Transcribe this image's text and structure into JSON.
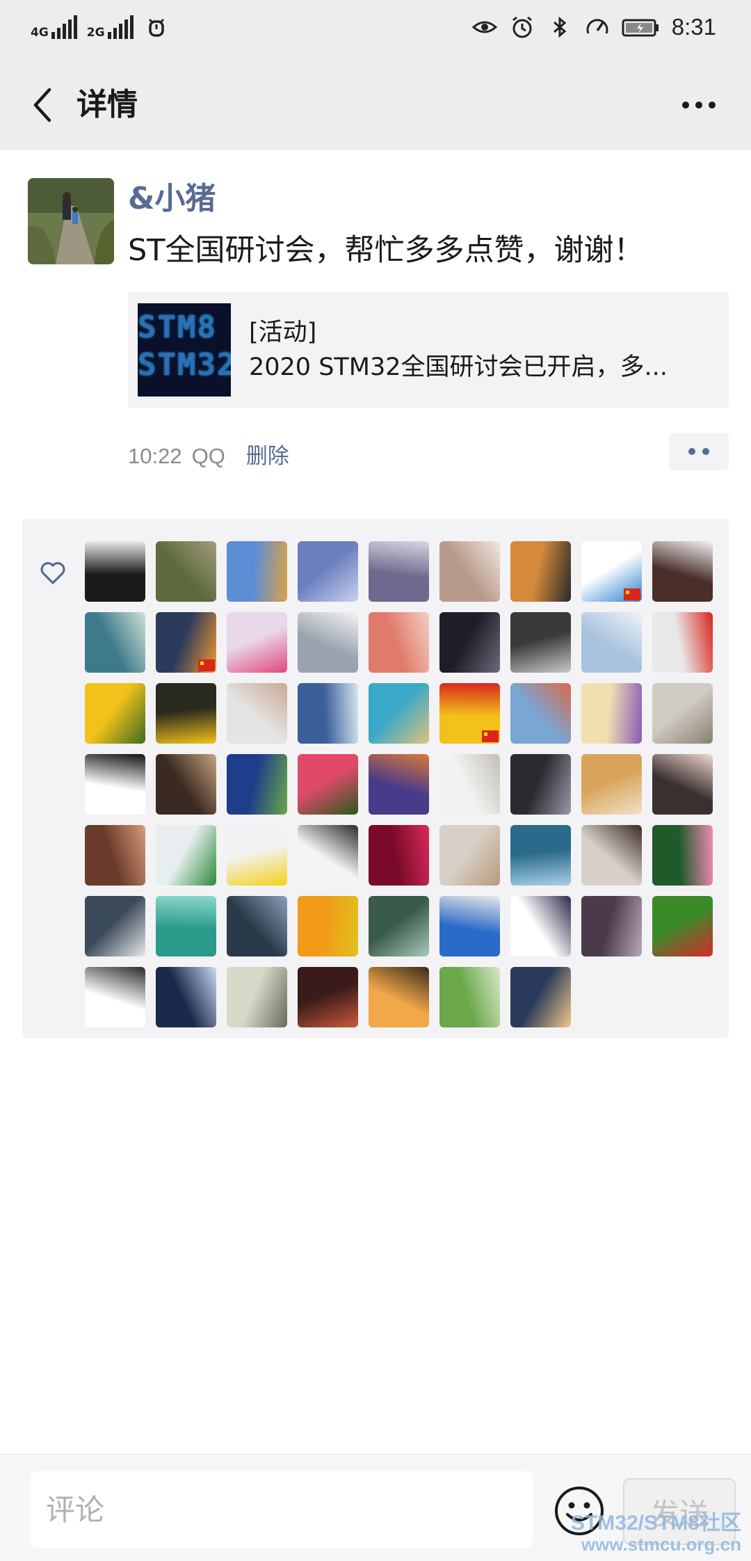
{
  "status_bar": {
    "net1": "4G",
    "net2": "2G",
    "time": "8:31"
  },
  "nav": {
    "title": "详情"
  },
  "post": {
    "author": "&小猪",
    "text": "ST全国研讨会，帮忙多多点赞，谢谢！",
    "link": {
      "thumb_text_1": "STM8",
      "thumb_text_2": "STM32",
      "tag": "[活动]",
      "description": "2020 STM32全国研讨会已开启，多..."
    },
    "time": "10:22",
    "source": "QQ",
    "delete_label": "删除"
  },
  "likes": {
    "count": 61,
    "colors": {
      "heart": "#576b95",
      "link": "#576b95"
    }
  },
  "comment_bar": {
    "placeholder": "评论",
    "send_label": "发送"
  },
  "watermark": {
    "line1": "STM32/STM8社区",
    "line2": "www.stmcu.org.cn"
  }
}
